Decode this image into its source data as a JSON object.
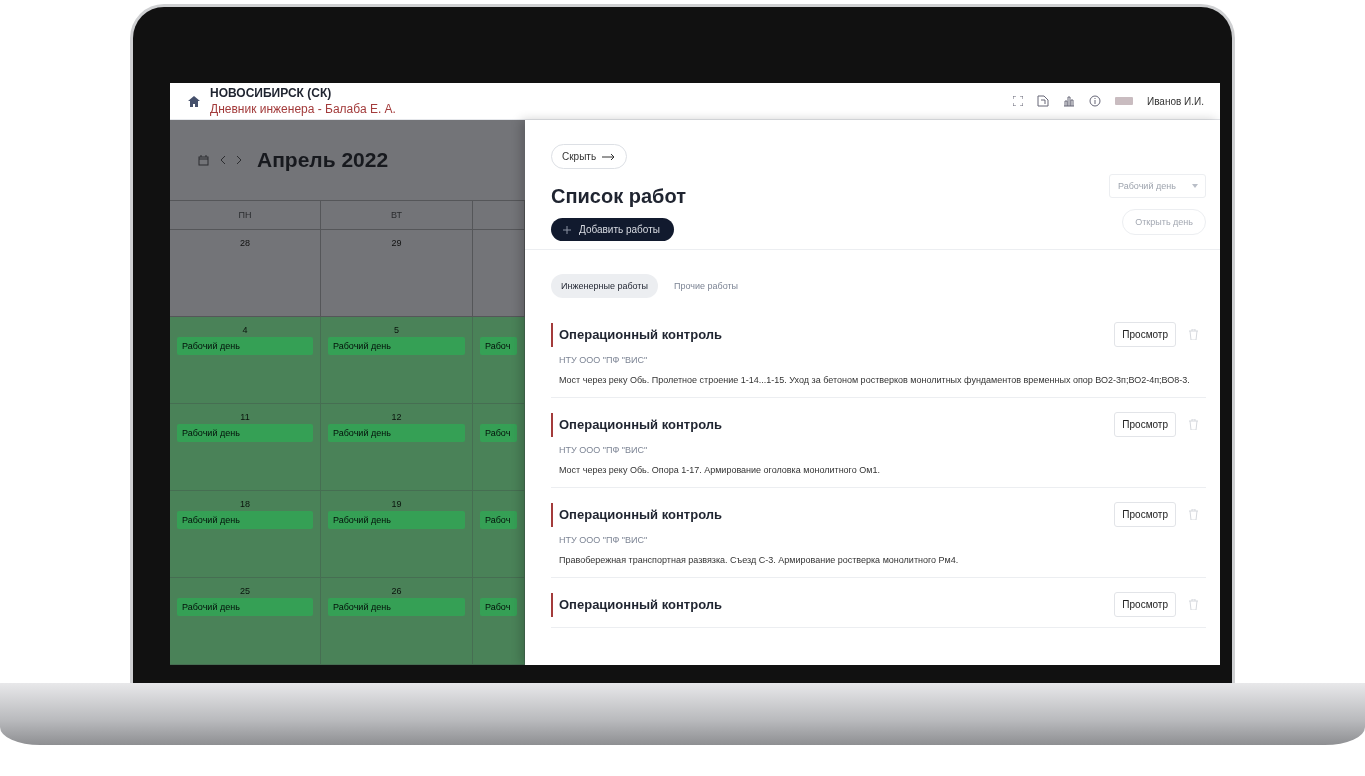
{
  "header": {
    "title": "НОВОСИБИРСК (СК)",
    "subtitle": "Дневник инженера - Балаба Е. А.",
    "user": "Иванов И.И."
  },
  "calendar": {
    "month": "Апрель 2022",
    "weekdays": [
      "ПН",
      "ВТ"
    ],
    "weeks": [
      {
        "days": [
          {
            "number": "28",
            "working": false
          },
          {
            "number": "29",
            "working": false
          },
          {
            "working": false
          }
        ]
      },
      {
        "days": [
          {
            "number": "4",
            "working": true,
            "chip": "Рабочий день"
          },
          {
            "number": "5",
            "working": true,
            "chip": "Рабочий день"
          },
          {
            "working": true,
            "chip": "Рабоч"
          }
        ]
      },
      {
        "days": [
          {
            "number": "11",
            "working": true,
            "chip": "Рабочий день"
          },
          {
            "number": "12",
            "working": true,
            "chip": "Рабочий день"
          },
          {
            "working": true,
            "chip": "Рабоч"
          }
        ]
      },
      {
        "days": [
          {
            "number": "18",
            "working": true,
            "chip": "Рабочий день"
          },
          {
            "number": "19",
            "working": true,
            "chip": "Рабочий день"
          },
          {
            "working": true,
            "chip": "Рабоч"
          }
        ]
      },
      {
        "days": [
          {
            "number": "25",
            "working": true,
            "chip": "Рабочий день"
          },
          {
            "number": "26",
            "working": true,
            "chip": "Рабочий день"
          },
          {
            "working": true,
            "chip": "Рабоч"
          }
        ]
      }
    ]
  },
  "panel": {
    "hide_button": "Скрыть",
    "title": "Список работ",
    "add_button": "Добавить работы",
    "day_type": {
      "placeholder": "Рабочий день"
    },
    "open_day_button": {
      "label": "Открыть день",
      "disabled": true
    },
    "tabs": [
      {
        "label": "Инженерные работы",
        "selected": true
      },
      {
        "label": "Прочие работы",
        "selected": false
      }
    ],
    "works": [
      {
        "title": "Операционный контроль",
        "org": "НТУ ООО \"ПФ \"ВИС\"",
        "description": "Мост через реку Обь. Пролетное строение 1-14...1-15. Уход за бетоном ростверков монолитных фундаментов временных опор ВО2-3п;ВО2-4п;ВО8-3.",
        "view_button": "Просмотр"
      },
      {
        "title": "Операционный контроль",
        "org": "НТУ ООО \"ПФ \"ВИС\"",
        "description": "Мост через реку Обь. Опора 1-17. Армирование оголовка монолитного Ом1.",
        "view_button": "Просмотр"
      },
      {
        "title": "Операционный контроль",
        "org": "НТУ ООО \"ПФ \"ВИС\"",
        "description": "Правобережная транспортная развязка. Съезд С-3. Армирование ростверка монолитного Рм4.",
        "view_button": "Просмотр"
      },
      {
        "title": "Операционный контроль",
        "view_button": "Просмотр"
      }
    ]
  }
}
